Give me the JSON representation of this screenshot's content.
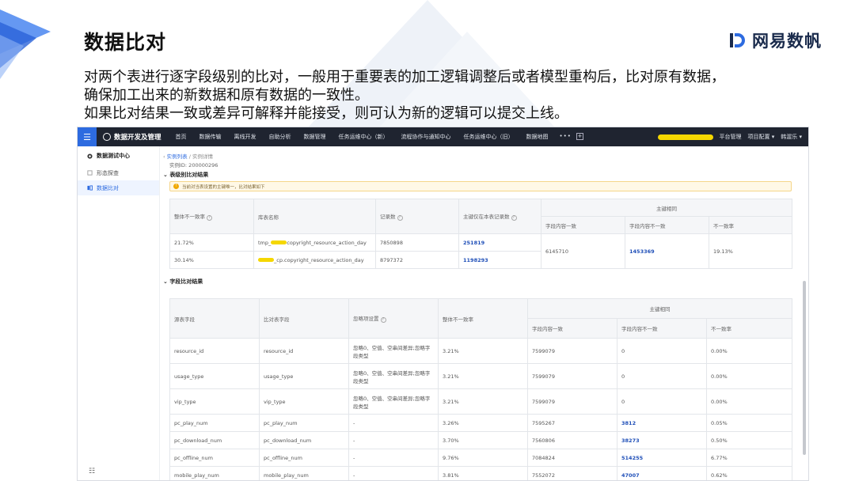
{
  "slide": {
    "title": "数据比对",
    "brand": "网易数帆",
    "desc_lines": [
      "对两个表进行逐字段级别的比对，一般用于重要表的加工逻辑调整后或者模型重构后，比对原有数据，",
      "确保加工出来的新数据和原有数据的一致性。",
      "如果比对结果一致或差异可解释并能接受，则可认为新的逻辑可以提交上线。"
    ],
    "accent_color": "#2d6be0"
  },
  "app": {
    "name": "数据开发及管理",
    "nav": [
      "首页",
      "数据传输",
      "离线开发",
      "自助分析",
      "数据管理",
      "任务运维中心（新）",
      "流程协作与通知中心",
      "任务运维中心（旧）",
      "数据地图"
    ],
    "more": "•••",
    "right": [
      "平台管理",
      "项目配置 ▾",
      "韩渥乐 ▾"
    ],
    "sidebar": {
      "head": "数据测试中心",
      "items": [
        "形态探查",
        "数据比对"
      ]
    },
    "breadcrumb": {
      "parent": "实例列表",
      "sep": "/",
      "current": "实例详情"
    },
    "instance_id": "实例ID: 200000296",
    "table_section": {
      "title": "表级别比对结果",
      "notice": "当前对当表设置的主键唯一，比对结果如下",
      "headers": [
        "整体不一致率",
        "库表名称",
        "记录数",
        "主键仅在本表记录数",
        "主键相同",
        "字段内容一致",
        "字段内容不一致",
        "不一致率"
      ],
      "rows": [
        {
          "rate": "21.72%",
          "name_prefix": "tmp_",
          "name": "copyright_resource_action_day",
          "records": "7850898",
          "only": "251819"
        },
        {
          "rate": "30.14%",
          "name_prefix": "",
          "name": "_cp.copyright_resource_action_day",
          "records": "8797372",
          "only": "1198293"
        }
      ],
      "merged": {
        "same": "6145710",
        "diff": "1453369",
        "diff_rate": "19.13%"
      }
    },
    "field_section": {
      "title": "字段比对结果",
      "headers": [
        "源表字段",
        "比对表字段",
        "忽略项设置",
        "整体不一致率",
        "主键相同",
        "字段内容一致",
        "字段内容不一致",
        "不一致率"
      ],
      "rows": [
        {
          "src": "resource_id",
          "cmp": "resource_id",
          "ignore": "忽略0、空值、空串间差异;忽略字段类型",
          "rate": "3.21%",
          "same": "7599079",
          "diff": "0",
          "diff_rate": "0.00%"
        },
        {
          "src": "usage_type",
          "cmp": "usage_type",
          "ignore": "忽略0、空值、空串间差异;忽略字段类型",
          "rate": "3.21%",
          "same": "7599079",
          "diff": "0",
          "diff_rate": "0.00%"
        },
        {
          "src": "vip_type",
          "cmp": "vip_type",
          "ignore": "忽略0、空值、空串间差异;忽略字段类型",
          "rate": "3.21%",
          "same": "7599079",
          "diff": "0",
          "diff_rate": "0.00%"
        },
        {
          "src": "pc_play_num",
          "cmp": "pc_play_num",
          "ignore": "-",
          "rate": "3.26%",
          "same": "7595267",
          "diff": "3812",
          "diff_rate": "0.05%"
        },
        {
          "src": "pc_download_num",
          "cmp": "pc_download_num",
          "ignore": "-",
          "rate": "3.70%",
          "same": "7560806",
          "diff": "38273",
          "diff_rate": "0.50%"
        },
        {
          "src": "pc_offline_num",
          "cmp": "pc_offline_num",
          "ignore": "-",
          "rate": "9.76%",
          "same": "7084824",
          "diff": "514255",
          "diff_rate": "6.77%"
        },
        {
          "src": "mobile_play_num",
          "cmp": "mobile_play_num",
          "ignore": "-",
          "rate": "3.81%",
          "same": "7552072",
          "diff": "47007",
          "diff_rate": "0.62%"
        }
      ]
    }
  }
}
